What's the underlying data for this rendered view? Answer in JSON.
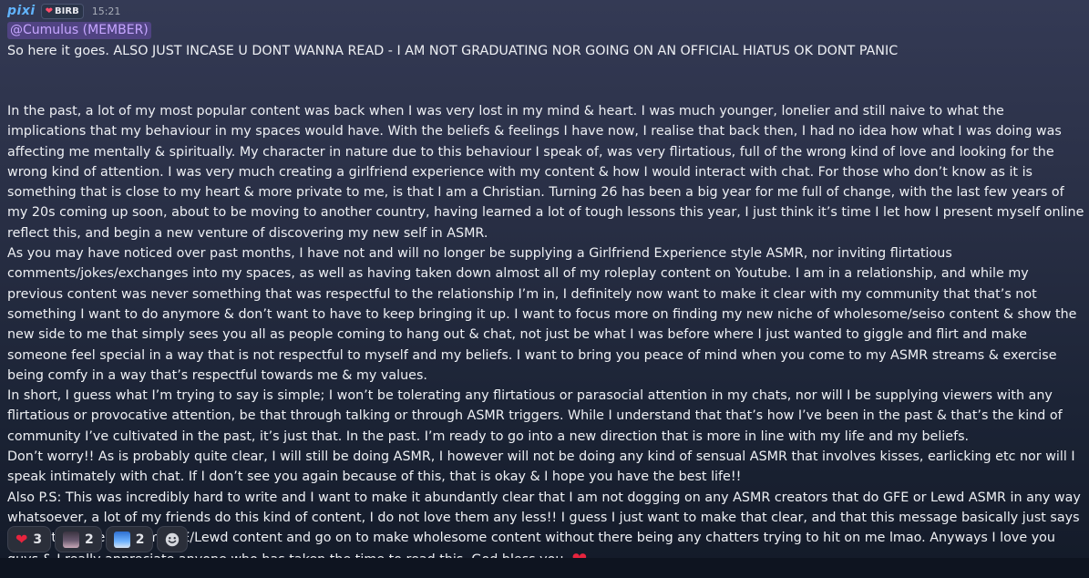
{
  "header": {
    "author": "pixi",
    "tag_heart": "❤",
    "tag_label": "BIRB",
    "time": "15:21"
  },
  "mention": "@Cumulus (MEMBER)",
  "message": {
    "first_line": "So here it goes. ALSO JUST INCASE U DONT WANNA READ - I AM NOT GRADUATING NOR GOING ON AN OFFICIAL HIATUS OK DONT PANIC",
    "body": "In the past, a lot of my most popular content was back when I was very lost in my mind & heart. I was much younger, lonelier and still naive to what the implications that my behaviour in my spaces would have. With the beliefs & feelings I have now, I realise that back then, I had no idea how what I was doing was affecting me mentally & spiritually. My character in nature due to this behaviour I speak of, was very flirtatious, full of the wrong kind of love and looking for the wrong kind of attention. I was very much creating a girlfriend experience with my content & how I would interact with chat. For those who don’t know as it is something that is close to my heart & more private to me, is that I am a Christian. Turning 26 has been a big year for me full of change, with the last few years of my 20s coming up soon, about to be moving to another country, having learned a lot of tough lessons this year, I just think it’s time I let how I present myself online reflect this, and begin a new venture of discovering my new self in ASMR.\nAs you may have noticed over past months, I have not and will no longer be supplying a Girlfriend Experience style ASMR, nor inviting flirtatious comments/jokes/exchanges into my spaces, as well as having taken down almost all of my roleplay content on Youtube. I am in a relationship, and while my previous content was never something that was respectful to the relationship I’m in, I definitely now want to make it clear with my community that that’s not something I want to do anymore & don’t want to have to keep bringing it up. I want to focus more on finding my new niche of wholesome/seiso content & show the new side to me that simply sees you all as people coming to hang out & chat, not just be what I was before where I just wanted to giggle and flirt and make someone feel special in a way that is not respectful to myself and my beliefs. I want to bring you peace of mind when you come to my ASMR streams & exercise being comfy in a way that’s respectful towards me & my values.\nIn short, I guess what I’m trying to say is simple; I won’t be tolerating any flirtatious or parasocial attention in my chats, nor will I be supplying viewers with any flirtatious or provocative attention, be that through talking or through ASMR triggers. While I understand that that’s how I’ve been in the past & that’s the kind of community I’ve cultivated in the past, it’s just that. In the past. I’m ready to go into a new direction that is more in line with my life and my beliefs.\nDon’t worry!! As is probably quite clear, I will still be doing ASMR, I however will not be doing any kind of sensual ASMR that involves kisses, earlicking etc nor will I speak intimately with chat. If I don’t see you again because of this, that is okay & I hope you have the best life!!\nAlso P.S: This was incredibly hard to write and I want to make it abundantly clear that I am not dogging on any ASMR creators that do GFE or Lewd ASMR in any way whatsoever, a lot of my friends do this kind of content, I do not love them any less!! I guess I just want to make that clear, and that this message basically just says I want to move on from GFE/Lewd content and go on to make wholesome content without there being any chatters trying to hit on me lmao. Anyways I love you guys & I really appreciate anyone who has taken the time to read this. God bless you. ",
    "end_emoji": "❤"
  },
  "reactions": [
    {
      "emoji": "heart-emoji",
      "glyph": "❤",
      "count": "3"
    },
    {
      "emoji": "custom-face-emoji",
      "count": "2"
    },
    {
      "emoji": "custom-blue-emoji",
      "count": "2"
    }
  ],
  "add_reaction_icon": "smile-icon",
  "colors": {
    "author": "#61b4ff",
    "mention_bg": "#895adc",
    "heart": "#e7243e"
  }
}
